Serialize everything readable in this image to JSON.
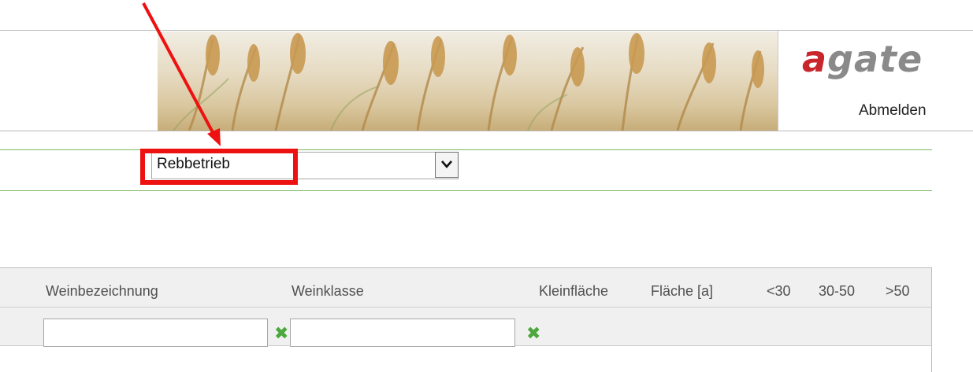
{
  "header": {
    "logo": {
      "lead": "a",
      "rest": "gate"
    },
    "logout_label": "Abmelden"
  },
  "filter": {
    "selected_value": "Rebbetrieb"
  },
  "table": {
    "columns": {
      "weinbezeichnung": "Weinbezeichnung",
      "weinklasse": "Weinklasse",
      "kleinflaeche": "Kleinfläche",
      "flaeche": "Fläche [a]",
      "lt30": "<30",
      "r30_50": "30-50",
      "gt50": ">50"
    },
    "filter_row": {
      "weinbezeichnung_value": "",
      "weinklasse_value": ""
    }
  },
  "colors": {
    "highlight": "#ee1111",
    "green_rule": "#7bb662",
    "clear_icon": "#4ca83c",
    "logo_red": "#c8252c",
    "logo_grey": "#8a8a8a"
  }
}
